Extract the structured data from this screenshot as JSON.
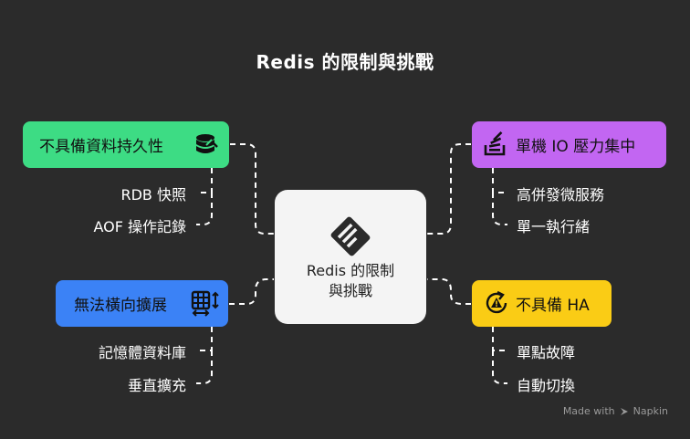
{
  "title": "Redis 的限制與挑戰",
  "center": {
    "line1": "Redis 的限制",
    "line2": "與挑戰",
    "icon": "document-icon"
  },
  "nodes": {
    "top_left": {
      "label": "不具備資料持久性",
      "icon": "database-icon",
      "color": "#3ddc84",
      "leaves": [
        "RDB 快照",
        "AOF 操作記錄"
      ]
    },
    "bottom_left": {
      "label": "無法橫向擴展",
      "icon": "table-scale-icon",
      "color": "#3b82f6",
      "leaves": [
        "記憶體資料庫",
        "垂直擴充"
      ]
    },
    "top_right": {
      "label": "單機 IO 壓力集中",
      "icon": "stack-overflow-icon",
      "color": "#c266f2",
      "leaves": [
        "高併發微服務",
        "單一執行緒"
      ]
    },
    "bottom_right": {
      "label": "不具備 HA",
      "icon": "warning-refresh-icon",
      "color": "#facc15",
      "leaves": [
        "單點故障",
        "自動切換"
      ]
    }
  },
  "footer": {
    "made_with": "Made with",
    "brand": "Napkin"
  }
}
